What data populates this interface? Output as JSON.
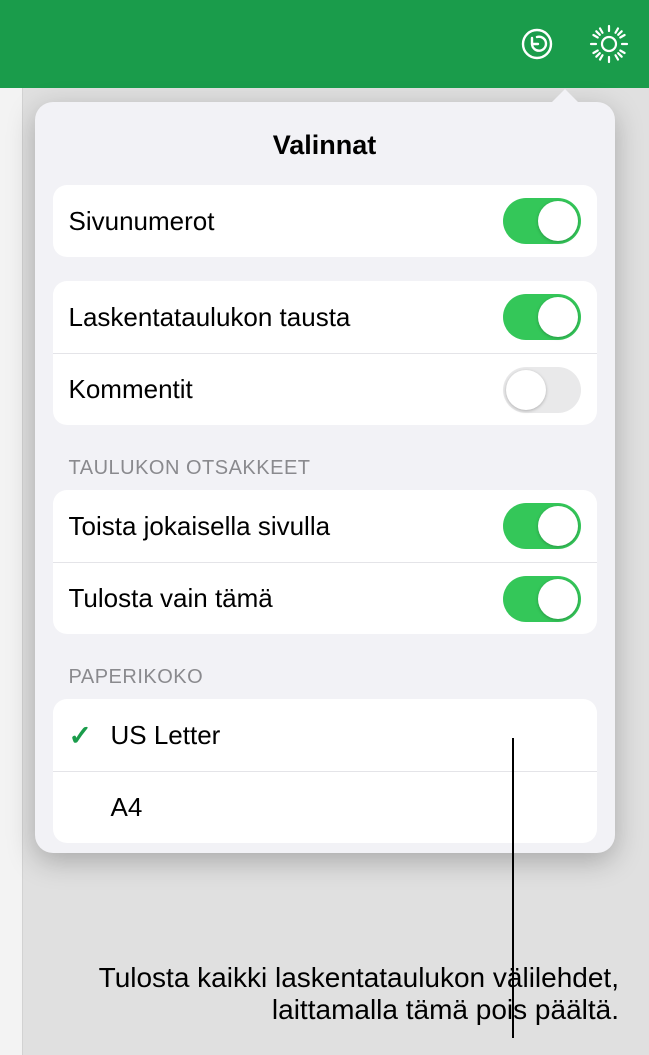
{
  "toolbar": {
    "undo_icon": "undo-icon",
    "settings_icon": "gear-icon"
  },
  "popover": {
    "title": "Valinnat",
    "options1": [
      {
        "label": "Sivunumerot",
        "on": true
      }
    ],
    "options2": [
      {
        "label": "Laskentataulukon tausta",
        "on": true
      },
      {
        "label": "Kommentit",
        "on": false
      }
    ],
    "section_headers_label": "TAULUKON OTSAKKEET",
    "headers": [
      {
        "label": "Toista jokaisella sivulla",
        "on": true
      },
      {
        "label": "Tulosta vain tämä",
        "on": true
      }
    ],
    "section_paper_label": "PAPERIKOKO",
    "paper_sizes": [
      {
        "label": "US Letter",
        "checked": true
      },
      {
        "label": "A4",
        "checked": false
      }
    ]
  },
  "callout": {
    "text": "Tulosta kaikki laskentataulukon välilehdet, laittamalla tämä pois päältä."
  }
}
